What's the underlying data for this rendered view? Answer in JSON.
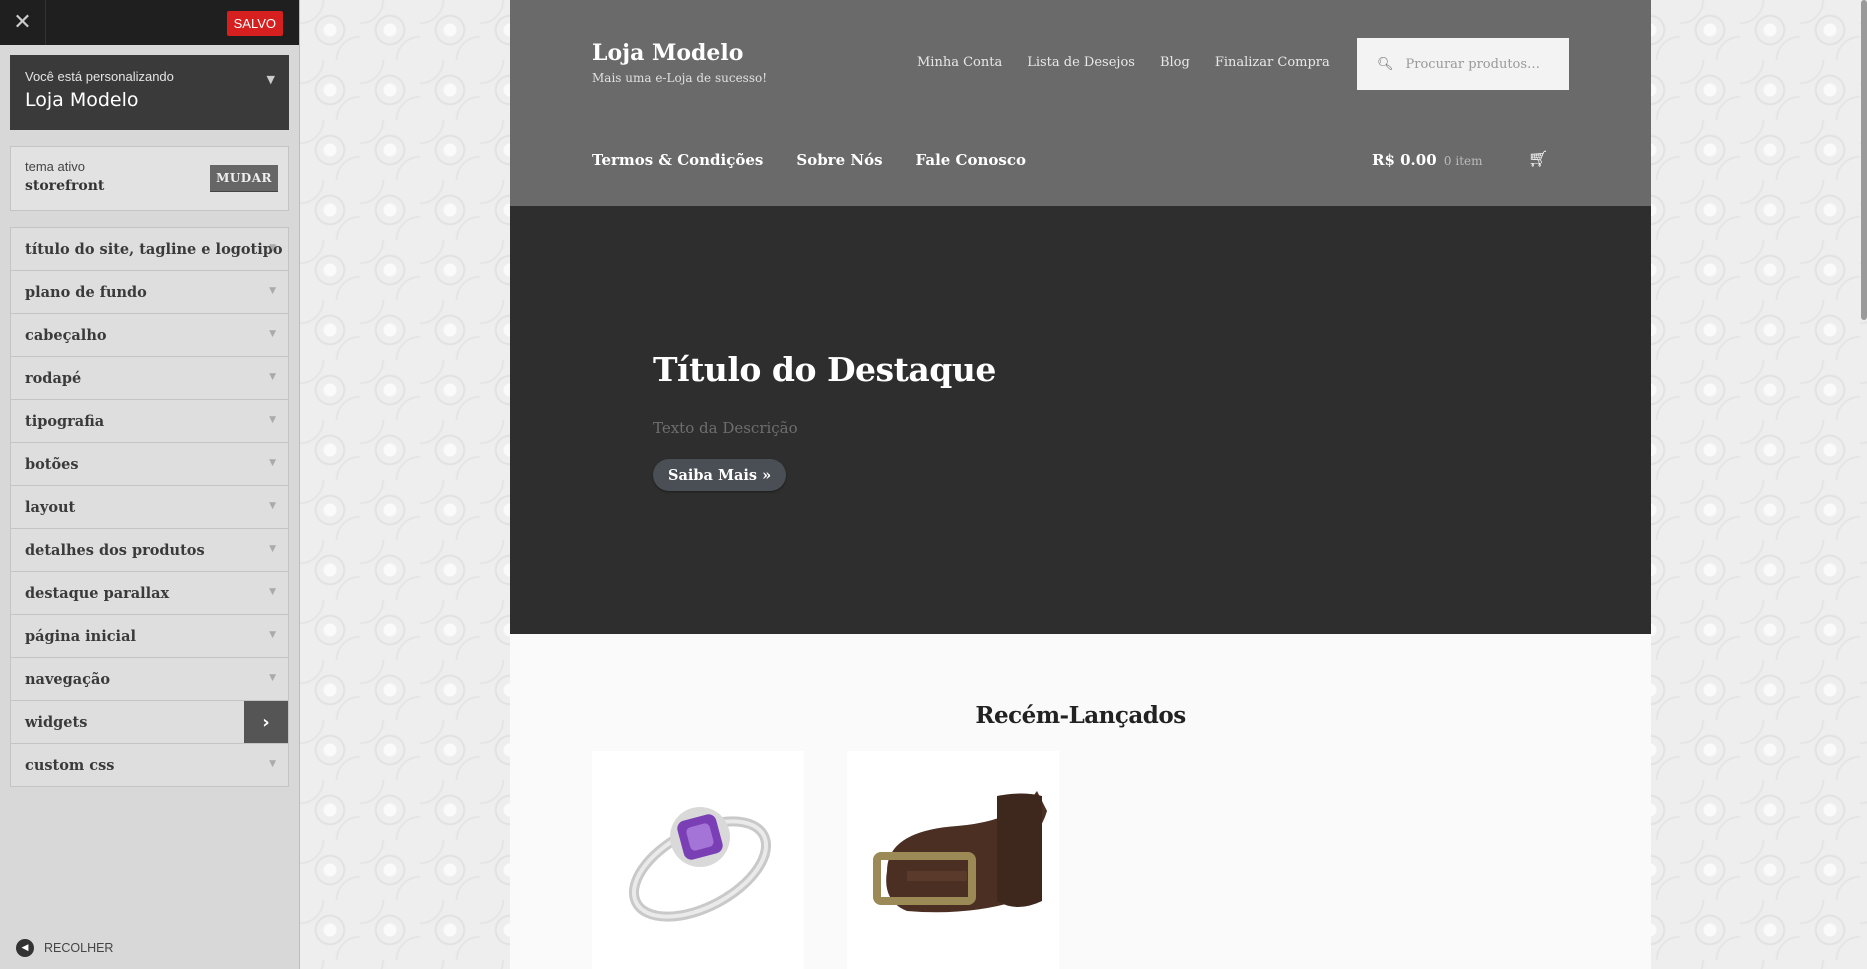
{
  "customizer": {
    "close_icon": "close-icon",
    "saved_label": "SALVO",
    "customizing_label": "Você está personalizando",
    "site_name": "Loja Modelo",
    "active_theme_label": "tema ativo",
    "active_theme_name": "storefront",
    "change_label": "MUDAR",
    "sections": [
      {
        "label": "título do site, tagline e logotipo"
      },
      {
        "label": "plano de fundo"
      },
      {
        "label": "cabeçalho"
      },
      {
        "label": "rodapé"
      },
      {
        "label": "tipografia"
      },
      {
        "label": "botões"
      },
      {
        "label": "layout"
      },
      {
        "label": "detalhes dos produtos"
      },
      {
        "label": "destaque parallax"
      },
      {
        "label": "página inicial"
      },
      {
        "label": "navegação"
      },
      {
        "label": "widgets"
      },
      {
        "label": "custom css"
      }
    ],
    "collapse_label": "RECOLHER"
  },
  "site": {
    "title": "Loja Modelo",
    "tagline": "Mais uma e-Loja de sucesso!",
    "secondary_nav": [
      "Minha Conta",
      "Lista de Desejos",
      "Blog",
      "Finalizar Compra"
    ],
    "search_placeholder": "Procurar produtos…",
    "primary_nav": [
      "Termos & Condições",
      "Sobre Nós",
      "Fale Conosco"
    ],
    "cart_total": "R$ 0.00",
    "cart_items": "0 item",
    "hero": {
      "title": "Título do Destaque",
      "description": "Texto da Descrição",
      "button": "Saiba Mais »"
    },
    "products_heading": "Recém-Lançados"
  },
  "colors": {
    "saved_red": "#d61f1f",
    "header_bg": "#6a6a6a",
    "hero_bg": "#2e2e2e",
    "sidebar_bg": "#d8d8d8"
  }
}
